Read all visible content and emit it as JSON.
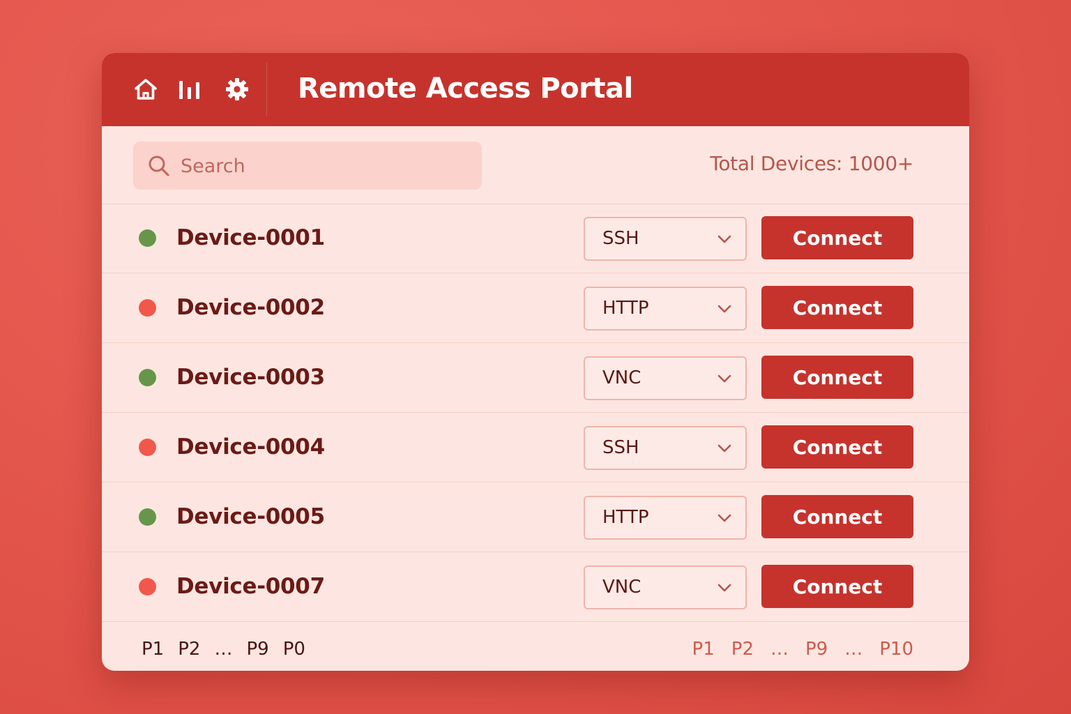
{
  "header": {
    "title": "Remote Access Portal",
    "icons": [
      "home-icon",
      "bar-chart-icon",
      "gear-icon"
    ]
  },
  "search": {
    "placeholder": "Search",
    "value": ""
  },
  "summary": {
    "total_devices": "Total Devices: 1000+"
  },
  "colors": {
    "accent": "#c6332d",
    "online": "#67964a",
    "offline": "#f2574c",
    "panel": "#fde6e1"
  },
  "devices": [
    {
      "name": "Device-0001",
      "status": "online",
      "protocol": "SSH",
      "action": "Connect"
    },
    {
      "name": "Device-0002",
      "status": "offline",
      "protocol": "HTTP",
      "action": "Connect"
    },
    {
      "name": "Device-0003",
      "status": "online",
      "protocol": "VNC",
      "action": "Connect"
    },
    {
      "name": "Device-0004",
      "status": "offline",
      "protocol": "SSH",
      "action": "Connect"
    },
    {
      "name": "Device-0005",
      "status": "online",
      "protocol": "HTTP",
      "action": "Connect"
    },
    {
      "name": "Device-0007",
      "status": "offline",
      "protocol": "VNC",
      "action": "Connect"
    }
  ],
  "pagination": {
    "left": [
      "P1",
      "P2",
      "…",
      "P9",
      "P0"
    ],
    "right": [
      "P1",
      "P2",
      "…",
      "P9",
      "…",
      "P10"
    ]
  }
}
